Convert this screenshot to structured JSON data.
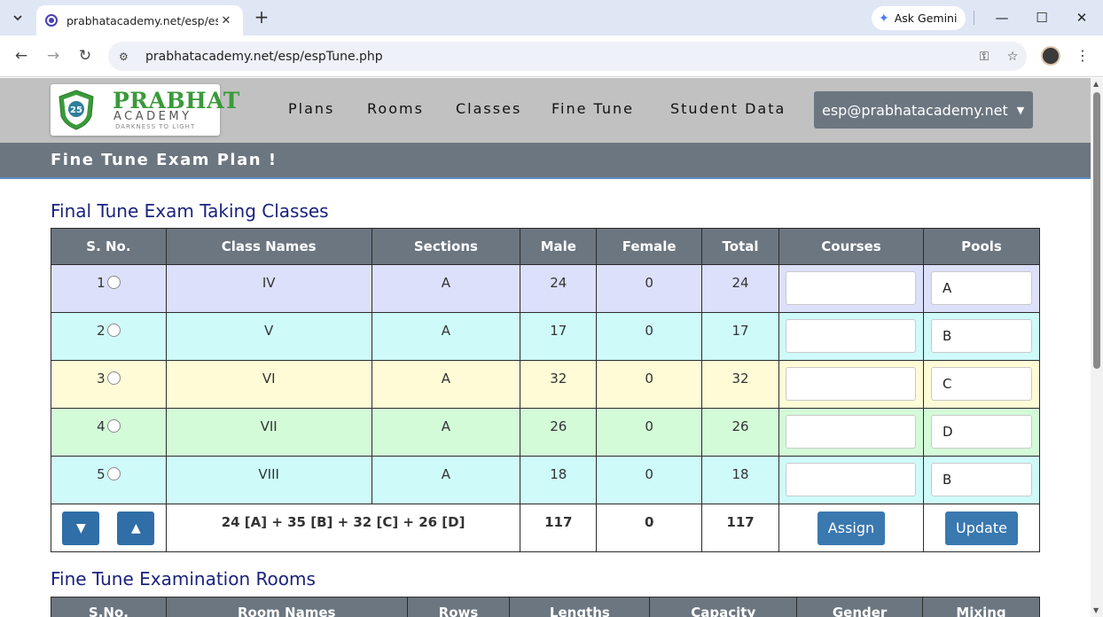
{
  "browser": {
    "tab_title": "prabhatacademy.net/esp/espTu",
    "url": "prabhatacademy.net/esp/espTune.php",
    "gemini_label": "Ask Gemini"
  },
  "site": {
    "logo": {
      "brand": "PRABHAT",
      "sub": "ACADEMY",
      "tagline": "DARKNESS TO LIGHT",
      "badge": "25"
    },
    "nav": [
      "Plans",
      "Rooms",
      "Classes",
      "Fine Tune",
      "Student Data"
    ],
    "user_email": "esp@prabhatacademy.net",
    "page_title": "Fine Tune Exam Plan !"
  },
  "classes_section": {
    "title": "Final Tune Exam Taking Classes",
    "headers": [
      "S. No.",
      "Class Names",
      "Sections",
      "Male",
      "Female",
      "Total",
      "Courses",
      "Pools"
    ],
    "rows": [
      {
        "sno": "1",
        "class": "IV",
        "section": "A",
        "male": "24",
        "female": "0",
        "total": "24",
        "course": "",
        "pool": "A"
      },
      {
        "sno": "2",
        "class": "V",
        "section": "A",
        "male": "17",
        "female": "0",
        "total": "17",
        "course": "",
        "pool": "B"
      },
      {
        "sno": "3",
        "class": "VI",
        "section": "A",
        "male": "32",
        "female": "0",
        "total": "32",
        "course": "",
        "pool": "C"
      },
      {
        "sno": "4",
        "class": "VII",
        "section": "A",
        "male": "26",
        "female": "0",
        "total": "26",
        "course": "",
        "pool": "D"
      },
      {
        "sno": "5",
        "class": "VIII",
        "section": "A",
        "male": "18",
        "female": "0",
        "total": "18",
        "course": "",
        "pool": "B"
      }
    ],
    "footer": {
      "down_glyph": "▼",
      "up_glyph": "▲",
      "summary": "24 [A] + 35 [B] + 32 [C] + 26 [D]",
      "male_total": "117",
      "female_total": "0",
      "grand_total": "117",
      "assign_label": "Assign",
      "update_label": "Update"
    }
  },
  "rooms_section": {
    "title": "Fine Tune Examination Rooms",
    "headers": [
      "S.No.",
      "Room Names",
      "Rows",
      "Lengths",
      "Capacity",
      "Gender",
      "Mixing"
    ]
  },
  "colors": {
    "header_gray": "#c1c1c1",
    "banner": "#6c7680",
    "heading_blue": "#1a237e",
    "button_blue": "#3a78b0",
    "row_colors": [
      "#dde0fb",
      "#cefbfa",
      "#fefbd6",
      "#d3fbd8",
      "#cefbfa"
    ]
  }
}
